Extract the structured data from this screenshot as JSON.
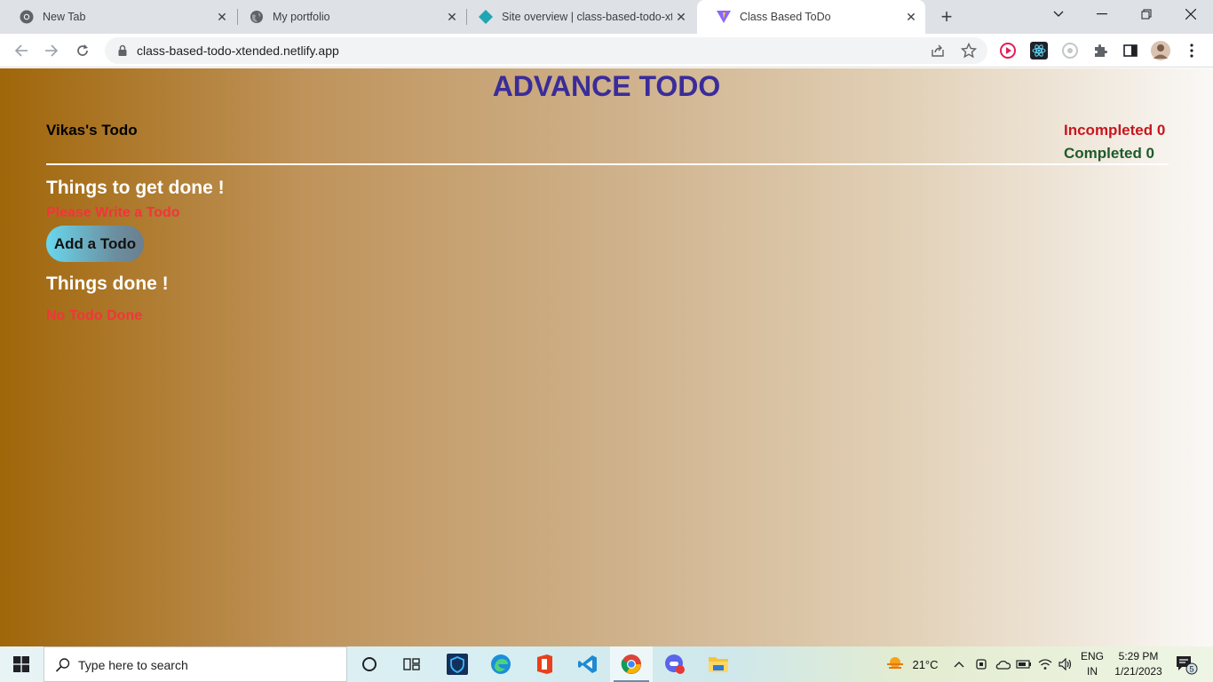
{
  "browser": {
    "tabs": [
      {
        "title": "New Tab",
        "favicon": "chrome-icon"
      },
      {
        "title": "My portfolio",
        "favicon": "globe-icon"
      },
      {
        "title": "Site overview | class-based-todo-xte",
        "favicon": "netlify-icon"
      },
      {
        "title": "Class Based ToDo",
        "favicon": "vite-icon",
        "active": true
      }
    ],
    "url": "class-based-todo-xtended.netlify.app"
  },
  "app": {
    "title": "ADVANCE TODO",
    "user_todo": "Vikas's Todo",
    "incompleted_label": "Incompleted 0",
    "completed_label": "Completed 0",
    "section_todo": "Things to get done !",
    "empty_todo_msg": "Please Write a Todo",
    "add_button": "Add a Todo",
    "section_done": "Things done !",
    "empty_done_msg": "No Todo Done"
  },
  "taskbar": {
    "search_placeholder": "Type here to search",
    "temperature": "21°C",
    "lang_top": "ENG",
    "lang_bottom": "IN",
    "time": "5:29 PM",
    "date": "1/21/2023",
    "notification_count": "5"
  },
  "colors": {
    "title": "#3a2c9a",
    "incomplete": "#c8161d",
    "complete": "#1e5a2a",
    "warning": "#f2353a"
  }
}
